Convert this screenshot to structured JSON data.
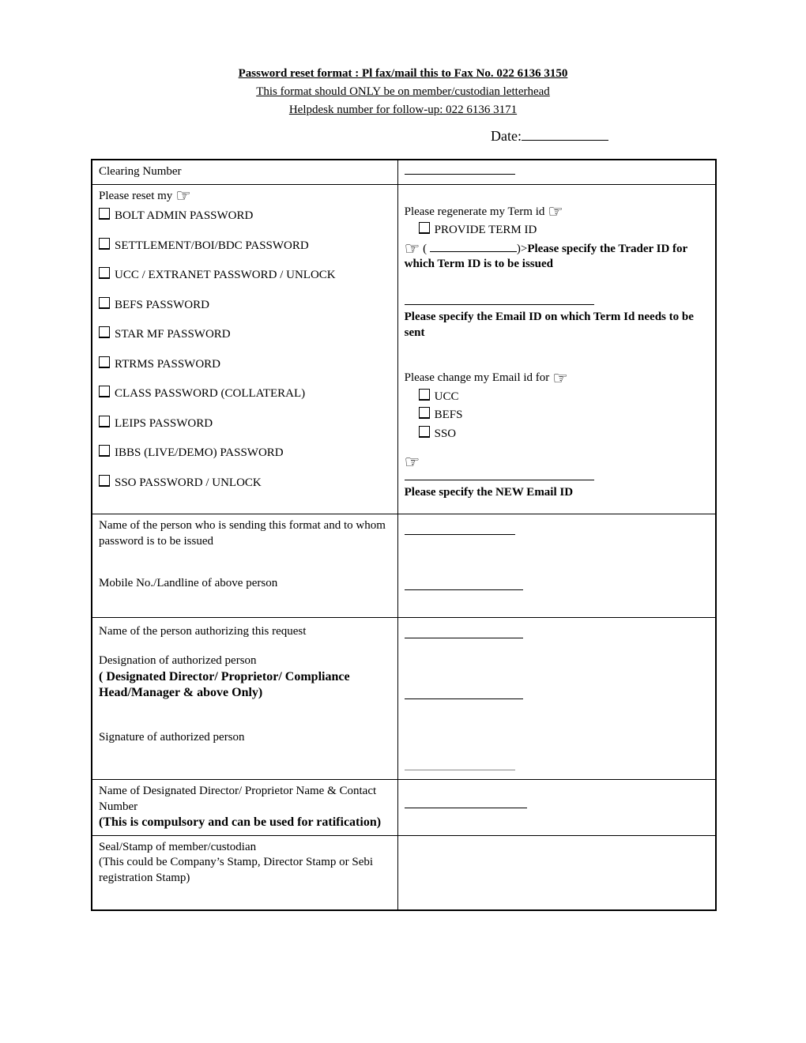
{
  "header": {
    "title": "Password reset format : Pl fax/mail this to Fax No. 022 6136 3150",
    "subtitle1": "This format should ONLY be on member/custodian letterhead",
    "subtitle2": "Helpdesk number for follow-up: 022 6136 3171 ",
    "date_label": "Date:"
  },
  "row1": {
    "clearing_label": "Clearing Number"
  },
  "row2_left": {
    "intro": "Please reset my ",
    "items": [
      "BOLT ADMIN PASSWORD",
      "SETTLEMENT/BOI/BDC PASSWORD",
      "UCC / EXTRANET PASSWORD / UNLOCK",
      "BEFS PASSWORD",
      "STAR MF PASSWORD",
      "RTRMS PASSWORD",
      "CLASS PASSWORD (COLLATERAL)",
      "LEIPS PASSWORD",
      "IBBS (LIVE/DEMO) PASSWORD",
      "SSO PASSWORD / UNLOCK"
    ]
  },
  "row2_right": {
    "regen_label": "Please regenerate my Term id ",
    "provide_term": "PROVIDE  TERM ID",
    "paren1": "( ",
    "paren2": ")>",
    "specify_trader": "Please specify the Trader ID for which Term ID is to be issued",
    "specify_email": "Please specify the Email ID on which Term Id needs to be sent",
    "change_email": "Please change my Email id for ",
    "email_opts": [
      "UCC",
      "BEFS",
      "SSO"
    ],
    "new_email": "Please specify the NEW Email ID"
  },
  "rows": {
    "sender": "Name of the person who is sending this format and to whom password is to be issued",
    "mobile": "Mobile No./Landline of  above person",
    "auth_name": "Name of the person authorizing this request",
    "designation": "Designation of  authorized person",
    "designation_note": "( Designated Director/ Proprietor/ Compliance Head/Manager & above Only)",
    "signature": "Signature of  authorized person",
    "director": "Name of Designated Director/ Proprietor Name & Contact Number",
    "director_note": "(This is compulsory and can be used for ratification)",
    "seal": "Seal/Stamp of member/custodian",
    "seal_note": "(This could be Company’s Stamp, Director Stamp or Sebi registration Stamp)"
  }
}
